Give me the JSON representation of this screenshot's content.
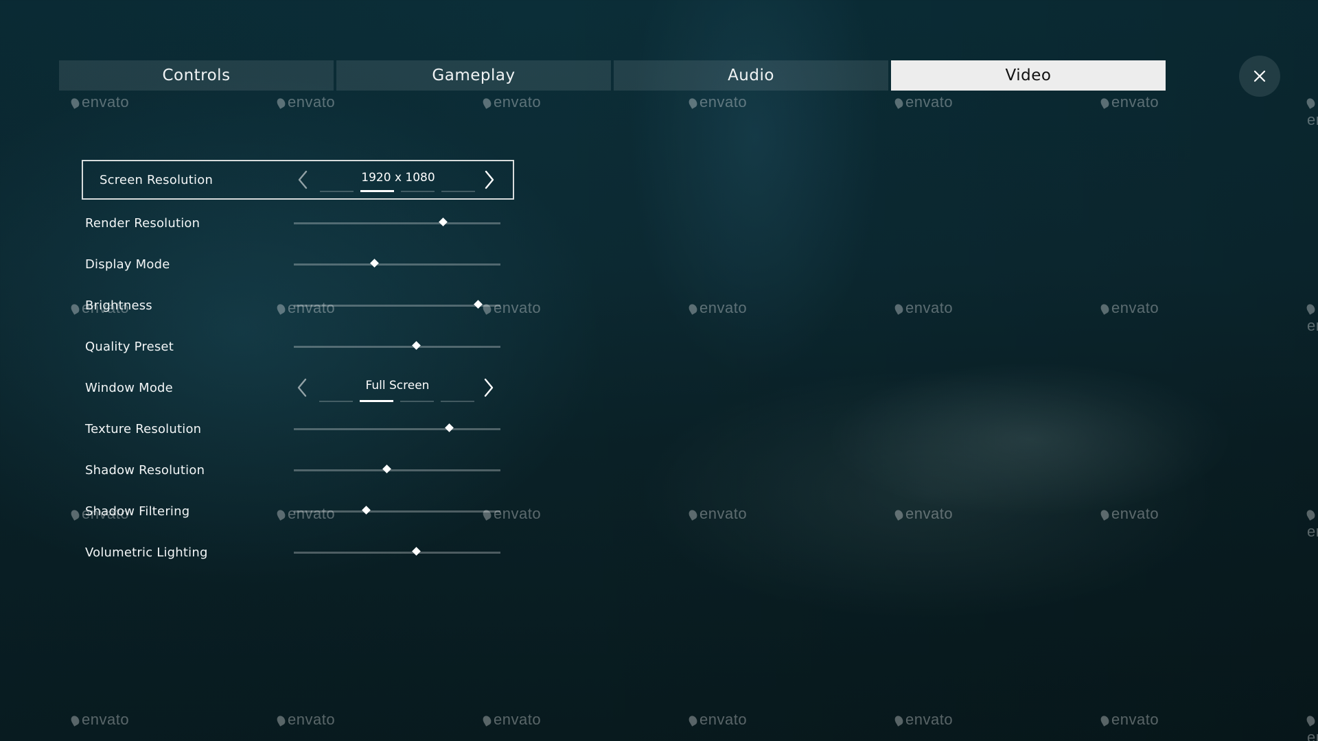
{
  "tabs": [
    {
      "label": "Controls",
      "active": false
    },
    {
      "label": "Gameplay",
      "active": false
    },
    {
      "label": "Audio",
      "active": false
    },
    {
      "label": "Video",
      "active": true
    }
  ],
  "watermark": "envato",
  "settings": [
    {
      "label": "Screen Resolution",
      "type": "selector",
      "value": "1920 x 1080",
      "option_count": 4,
      "option_index": 1,
      "selected": true
    },
    {
      "label": "Render Resolution",
      "type": "slider",
      "level": 0.72
    },
    {
      "label": "Display Mode",
      "type": "slider",
      "level": 0.39
    },
    {
      "label": "Brightness",
      "type": "slider",
      "level": 0.89
    },
    {
      "label": "Quality Preset",
      "type": "slider",
      "level": 0.59
    },
    {
      "label": "Window Mode",
      "type": "selector",
      "value": "Full Screen",
      "option_count": 4,
      "option_index": 1
    },
    {
      "label": "Texture Resolution",
      "type": "slider",
      "level": 0.75
    },
    {
      "label": "Shadow Resolution",
      "type": "slider",
      "level": 0.45
    },
    {
      "label": "Shadow Filtering",
      "type": "slider",
      "level": 0.35
    },
    {
      "label": "Volumetric Lighting",
      "type": "slider",
      "level": 0.59
    }
  ],
  "icons": {
    "close": "close-icon",
    "prev": "chevron-left-icon",
    "next": "chevron-right-icon"
  },
  "colors": {
    "active_tab_bg": "#ededed",
    "tab_bg": "rgba(255,255,255,0.10)",
    "accent": "#ffffff"
  }
}
